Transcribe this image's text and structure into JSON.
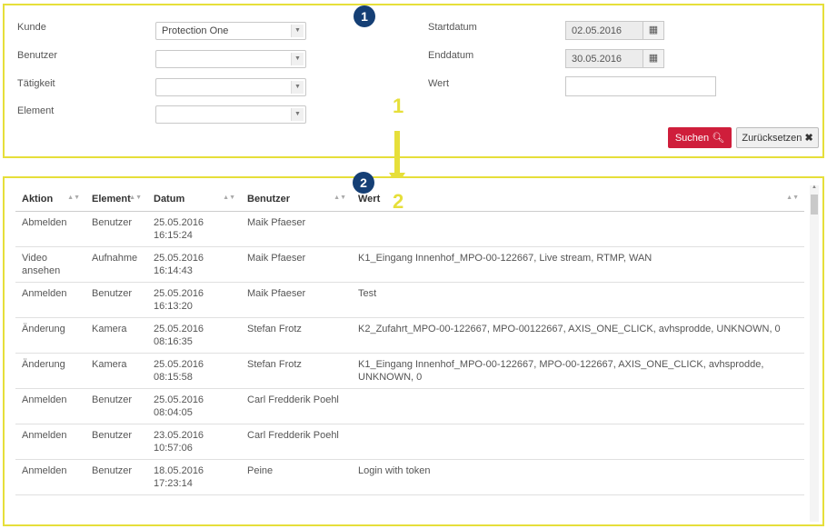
{
  "filters": {
    "kunde_label": "Kunde",
    "kunde_value": "Protection One",
    "benutzer_label": "Benutzer",
    "benutzer_value": "",
    "taetigkeit_label": "Tätigkeit",
    "taetigkeit_value": "",
    "element_label": "Element",
    "element_value": "",
    "startdatum_label": "Startdatum",
    "startdatum_value": "02.05.2016",
    "enddatum_label": "Enddatum",
    "enddatum_value": "30.05.2016",
    "wert_label": "Wert",
    "wert_value": "",
    "search_label": "Suchen",
    "reset_label": "Zurücksetzen"
  },
  "annotations": {
    "badge_1": "1",
    "badge_2": "2",
    "arrow_start": "1",
    "arrow_end": "2"
  },
  "icons": {
    "calendar": "calendar-icon",
    "search": "search-icon",
    "close": "close-icon",
    "caret": "caret-down-icon",
    "sort": "sort-icon"
  },
  "colors": {
    "highlight_border": "#e6df3a",
    "badge": "#153f75",
    "search_button": "#cf1e3b"
  },
  "table": {
    "columns": [
      "Aktion",
      "Element",
      "Datum",
      "Benutzer",
      "Wert"
    ],
    "rows": [
      {
        "aktion": "Abmelden",
        "element": "Benutzer",
        "datum": "25.05.2016",
        "zeit": "16:15:24",
        "benutzer": "Maik Pfaeser",
        "wert": ""
      },
      {
        "aktion": "Video ansehen",
        "element": "Aufnahme",
        "datum": "25.05.2016",
        "zeit": "16:14:43",
        "benutzer": "Maik Pfaeser",
        "wert": "K1_Eingang Innenhof_MPO-00-122667, Live stream, RTMP, WAN"
      },
      {
        "aktion": "Anmelden",
        "element": "Benutzer",
        "datum": "25.05.2016",
        "zeit": "16:13:20",
        "benutzer": "Maik Pfaeser",
        "wert": "Test"
      },
      {
        "aktion": "Änderung",
        "element": "Kamera",
        "datum": "25.05.2016",
        "zeit": "08:16:35",
        "benutzer": "Stefan Frotz",
        "wert": "K2_Zufahrt_MPO-00-122667, MPO-00122667, AXIS_ONE_CLICK, avhsprodde, UNKNOWN, 0"
      },
      {
        "aktion": "Änderung",
        "element": "Kamera",
        "datum": "25.05.2016",
        "zeit": "08:15:58",
        "benutzer": "Stefan Frotz",
        "wert": "K1_Eingang Innenhof_MPO-00-122667, MPO-00-122667, AXIS_ONE_CLICK, avhsprodde, UNKNOWN, 0"
      },
      {
        "aktion": "Anmelden",
        "element": "Benutzer",
        "datum": "25.05.2016",
        "zeit": "08:04:05",
        "benutzer": "Carl Fredderik Poehl",
        "wert": ""
      },
      {
        "aktion": "Anmelden",
        "element": "Benutzer",
        "datum": "23.05.2016",
        "zeit": "10:57:06",
        "benutzer": "Carl Fredderik Poehl",
        "wert": ""
      },
      {
        "aktion": "Anmelden",
        "element": "Benutzer",
        "datum": "18.05.2016",
        "zeit": "17:23:14",
        "benutzer": "Peine",
        "wert": "Login with token"
      }
    ]
  }
}
